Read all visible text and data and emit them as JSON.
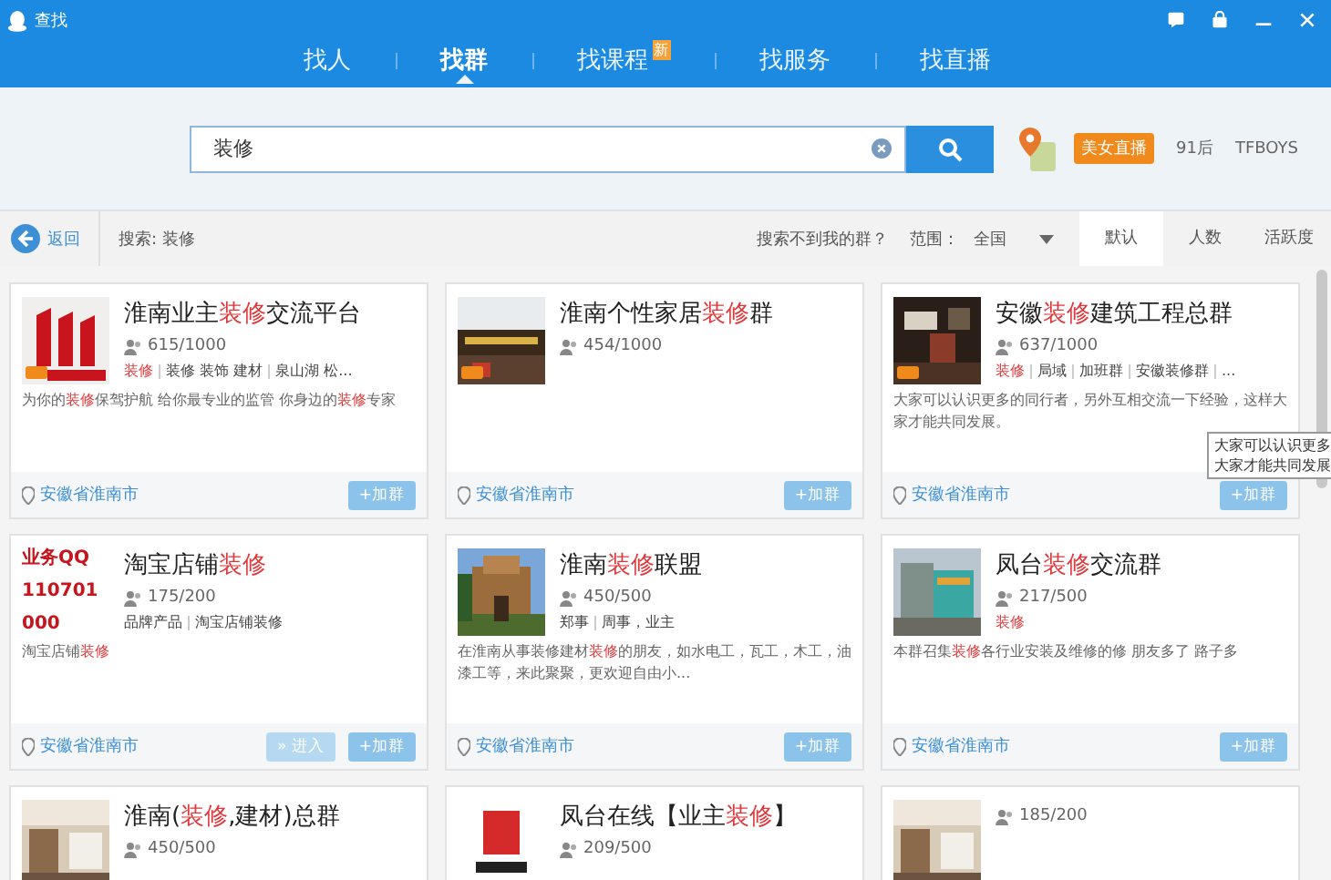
{
  "window": {
    "title": "查找"
  },
  "tabs": [
    {
      "label": "找人",
      "selected": false
    },
    {
      "label": "找群",
      "selected": true
    },
    {
      "label": "找课程",
      "selected": false,
      "badge": "新"
    },
    {
      "label": "找服务",
      "selected": false
    },
    {
      "label": "找直播",
      "selected": false
    }
  ],
  "search": {
    "value": "装修"
  },
  "hot_tags": [
    {
      "label": "美女直播",
      "kind": "badge"
    },
    {
      "label": "91后",
      "kind": "plain"
    },
    {
      "label": "TFBOYS",
      "kind": "plain"
    }
  ],
  "toolbar": {
    "back": "返回",
    "query": "搜索: 装修",
    "help_link": "搜索不到我的群？",
    "range_label": "范围：",
    "range_value": "全国",
    "sort_tabs": [
      {
        "label": "默认",
        "selected": true
      },
      {
        "label": "人数",
        "selected": false
      },
      {
        "label": "活跃度",
        "selected": false
      }
    ]
  },
  "groups": [
    {
      "avatar": {
        "kind": "logo"
      },
      "hot": true,
      "title": [
        {
          "text": "淮南业主",
          "hl": false
        },
        {
          "text": "装修",
          "hl": true
        },
        {
          "text": "交流平台",
          "hl": false
        }
      ],
      "members": "615/1000",
      "tags": [
        {
          "text": "装修",
          "hl": true
        },
        {
          "text": "装修 装饰 建材",
          "hl": false
        },
        {
          "text": "泉山湖 松...",
          "hl": false
        }
      ],
      "desc": [
        {
          "text": "为你的",
          "hl": false
        },
        {
          "text": "装修",
          "hl": true
        },
        {
          "text": "保驾护航 给你最专业的监管 你身边的",
          "hl": false
        },
        {
          "text": "装修",
          "hl": true
        },
        {
          "text": "专家",
          "hl": false
        }
      ],
      "location": "安徽省淮南市",
      "buttons": [
        {
          "label": "+加群",
          "kind": "join"
        }
      ]
    },
    {
      "avatar": {
        "kind": "picture"
      },
      "hot": true,
      "title": [
        {
          "text": "淮南个性家居",
          "hl": false
        },
        {
          "text": "装修",
          "hl": true
        },
        {
          "text": "群",
          "hl": false
        }
      ],
      "members": "454/1000",
      "location": "安徽省淮南市",
      "buttons": [
        {
          "label": "+加群",
          "kind": "join"
        }
      ]
    },
    {
      "avatar": {
        "kind": "picture"
      },
      "hot": true,
      "title": [
        {
          "text": "安徽",
          "hl": false
        },
        {
          "text": "装修",
          "hl": true
        },
        {
          "text": "建筑工程总群",
          "hl": false
        }
      ],
      "members": "637/1000",
      "tags": [
        {
          "text": "装修",
          "hl": true
        },
        {
          "text": "局域",
          "hl": false
        },
        {
          "text": "加班群",
          "hl": false
        },
        {
          "text": "安徽装修群",
          "hl": false
        },
        {
          "text": "...",
          "hl": false
        }
      ],
      "desc": [
        {
          "text": "大家可以认识更多的同行者，另外互相交流一下经验，这样大家才能共同发展。",
          "hl": false
        }
      ],
      "tooltip": [
        "大家可以认识更多",
        "大家才能共同发展"
      ],
      "location": "安徽省淮南市",
      "buttons": [
        {
          "label": "+加群",
          "kind": "join"
        }
      ]
    },
    {
      "avatar": {
        "kind": "text",
        "lines": [
          "业务QQ",
          "110701",
          "000"
        ]
      },
      "hot": false,
      "title": [
        {
          "text": "淘宝店铺",
          "hl": false
        },
        {
          "text": "装修",
          "hl": true
        }
      ],
      "members": "175/200",
      "tags": [
        {
          "text": "品牌产品",
          "hl": false
        },
        {
          "text": "淘宝店铺装修",
          "hl": false
        }
      ],
      "desc": [
        {
          "text": "淘宝店铺",
          "hl": false
        },
        {
          "text": "装修",
          "hl": true
        }
      ],
      "location": "安徽省淮南市",
      "buttons": [
        {
          "label": "» 进入",
          "kind": "enter"
        },
        {
          "label": "+加群",
          "kind": "join"
        }
      ]
    },
    {
      "avatar": {
        "kind": "picture"
      },
      "hot": false,
      "title": [
        {
          "text": "淮南",
          "hl": false
        },
        {
          "text": "装修",
          "hl": true
        },
        {
          "text": "联盟",
          "hl": false
        }
      ],
      "members": "450/500",
      "tags": [
        {
          "text": "郑事",
          "hl": false
        },
        {
          "text": "周事，业主",
          "hl": false
        }
      ],
      "desc": [
        {
          "text": "在淮南从事装修建材",
          "hl": false
        },
        {
          "text": "装修",
          "hl": true
        },
        {
          "text": "的朋友，如水电工，瓦工，木工，油漆工等，来此聚聚，更欢迎自由小...",
          "hl": false
        }
      ],
      "location": "安徽省淮南市",
      "buttons": [
        {
          "label": "+加群",
          "kind": "join"
        }
      ]
    },
    {
      "avatar": {
        "kind": "picture"
      },
      "hot": false,
      "title": [
        {
          "text": "凤台",
          "hl": false
        },
        {
          "text": "装修",
          "hl": true
        },
        {
          "text": "交流群",
          "hl": false
        }
      ],
      "members": "217/500",
      "tags": [
        {
          "text": "装修",
          "hl": true
        }
      ],
      "desc": [
        {
          "text": "本群召集",
          "hl": false
        },
        {
          "text": "装修",
          "hl": true
        },
        {
          "text": "各行业安装及维修的修 朋友多了 路子多",
          "hl": false
        }
      ],
      "location": "安徽省淮南市",
      "buttons": [
        {
          "label": "+加群",
          "kind": "join"
        }
      ]
    },
    {
      "avatar": {
        "kind": "picture"
      },
      "hot": false,
      "title": [
        {
          "text": "淮南(",
          "hl": false
        },
        {
          "text": "装修",
          "hl": true
        },
        {
          "text": ",建材)总群",
          "hl": false
        }
      ],
      "members": "450/500"
    },
    {
      "avatar": {
        "kind": "picture"
      },
      "hot": false,
      "title": [
        {
          "text": "凤台在线【业主",
          "hl": false
        },
        {
          "text": "装修",
          "hl": true
        },
        {
          "text": "】",
          "hl": false
        }
      ],
      "members": "209/500"
    },
    {
      "avatar": {
        "kind": "picture"
      },
      "hot": false,
      "members": "185/200"
    }
  ]
}
